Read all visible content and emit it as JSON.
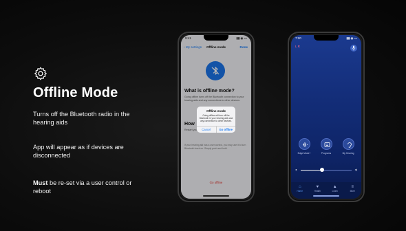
{
  "slide": {
    "title": "Offline Mode",
    "icon": "gear-icon",
    "para1": "Turns off the Bluetooth radio in the hearing aids",
    "para2": "App will appear as if devices are disconnected",
    "para3_bold": "Must",
    "para3_rest": " be re-set via a user control or reboot"
  },
  "left_phone": {
    "time": "9:41",
    "nav_back": "My settings",
    "nav_title": "Offline mode",
    "nav_done": "Done",
    "heading1": "What is offline mode?",
    "body1": "Going offline turns off the Bluetooth connection to your hearing aids and any connections to other devices.",
    "heading2": "How",
    "body2": "Restart your hearing aids",
    "body3": "If your hearing aid has a user control, you may use it to turn Bluetooth back on. Simply push and hold.",
    "dialog": {
      "title": "Offline mode",
      "message": "Going offline will turn off the Bluetooth in your hearing aids and any connection to other devices.",
      "cancel": "Cancel",
      "confirm": "Go offline"
    },
    "go_offline": "Go offline"
  },
  "right_phone": {
    "time": "7:20",
    "ear_indicator": "L R",
    "controls": [
      {
        "label": "Edge Mode+",
        "icon": "waveform-icon"
      },
      {
        "label": "Programs",
        "icon": "programs-icon"
      },
      {
        "label": "My Hearing",
        "icon": "ear-icon"
      }
    ],
    "tabs": [
      {
        "label": "Home",
        "active": true
      },
      {
        "label": "Health",
        "active": false
      },
      {
        "label": "Learn",
        "active": false
      },
      {
        "label": "More",
        "active": false
      }
    ],
    "volume_level": 0.42
  },
  "colors": {
    "accent_blue": "#1b73e8",
    "danger_red": "#e0312c",
    "app_bg": "#132d78"
  }
}
